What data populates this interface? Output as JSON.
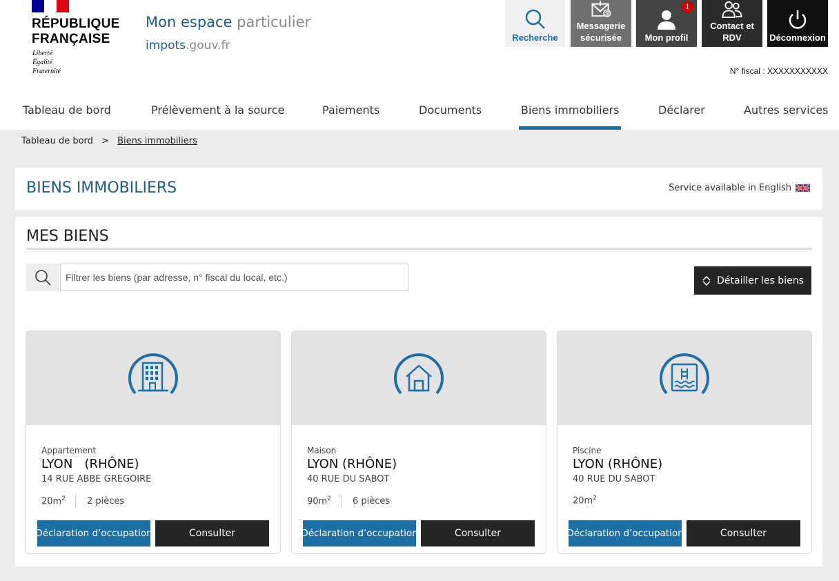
{
  "header": {
    "logo": {
      "line1": "RÉPUBLIQUE",
      "line2": "FRANÇAISE",
      "motto1": "Liberté",
      "motto2": "Égalité",
      "motto3": "Fraternité"
    },
    "app_name": {
      "part1": "Mon espace",
      "part2": "particulier"
    },
    "app_domain": {
      "part1": "impots",
      "part2": ".gouv.fr"
    },
    "buttons": [
      {
        "label": "Recherche",
        "icon": "search-icon"
      },
      {
        "label1": "Messagerie",
        "label2": "sécurisée",
        "icon": "envelope-at-icon"
      },
      {
        "label": "Mon profil",
        "icon": "user-icon",
        "badge": "!"
      },
      {
        "label1": "Contact et",
        "label2": "RDV",
        "icon": "people-icon"
      },
      {
        "label": "Déconnexion",
        "icon": "power-icon"
      }
    ],
    "fiscal_number": "N° fiscal : XXXXXXXXXXX"
  },
  "nav": {
    "items": [
      "Tableau de bord",
      "Prélèvement à la source",
      "Paiements",
      "Documents",
      "Biens immobiliers",
      "Déclarer",
      "Autres services"
    ],
    "active": "Biens immobiliers"
  },
  "breadcrumb": {
    "home": "Tableau de bord",
    "separator": ">",
    "current": "Biens immobiliers"
  },
  "page": {
    "title": "BIENS IMMOBILIERS",
    "english_link": "Service available in English"
  },
  "section": {
    "title": "MES BIENS",
    "filter_placeholder": "Filtrer les biens (par adresse, n° fiscal du local, etc.)",
    "detail_button": "Détailler les biens"
  },
  "properties": [
    {
      "type": "Appartement",
      "city": "LYON   (RHÔNE)",
      "street": "14 RUE ABBE GREGOIRE",
      "area": "20m",
      "area_unit_exp": "2",
      "rooms": "2 pièces",
      "icon": "building-icon",
      "decl_button": "Déclaration d’occupation",
      "consult_button": "Consulter"
    },
    {
      "type": "Maison",
      "city": "LYON (RHÔNE)",
      "street": "40 RUE DU SABOT",
      "area": "90m",
      "area_unit_exp": "2",
      "rooms": "6 pièces",
      "icon": "house-icon",
      "decl_button": "Déclaration d’occupation",
      "consult_button": "Consulter"
    },
    {
      "type": "Piscine",
      "city": "LYON (RHÔNE)",
      "street": "40 RUE DU SABOT",
      "area": "20m",
      "area_unit_exp": "2",
      "rooms": "",
      "icon": "pool-icon",
      "decl_button": "Déclaration d’occupation",
      "consult_button": "Consulter"
    }
  ],
  "colors": {
    "accent_blue": "#1d6fa8",
    "title_blue": "#1d5c85",
    "dark_button": "#252525",
    "background": "#ebebeb"
  }
}
